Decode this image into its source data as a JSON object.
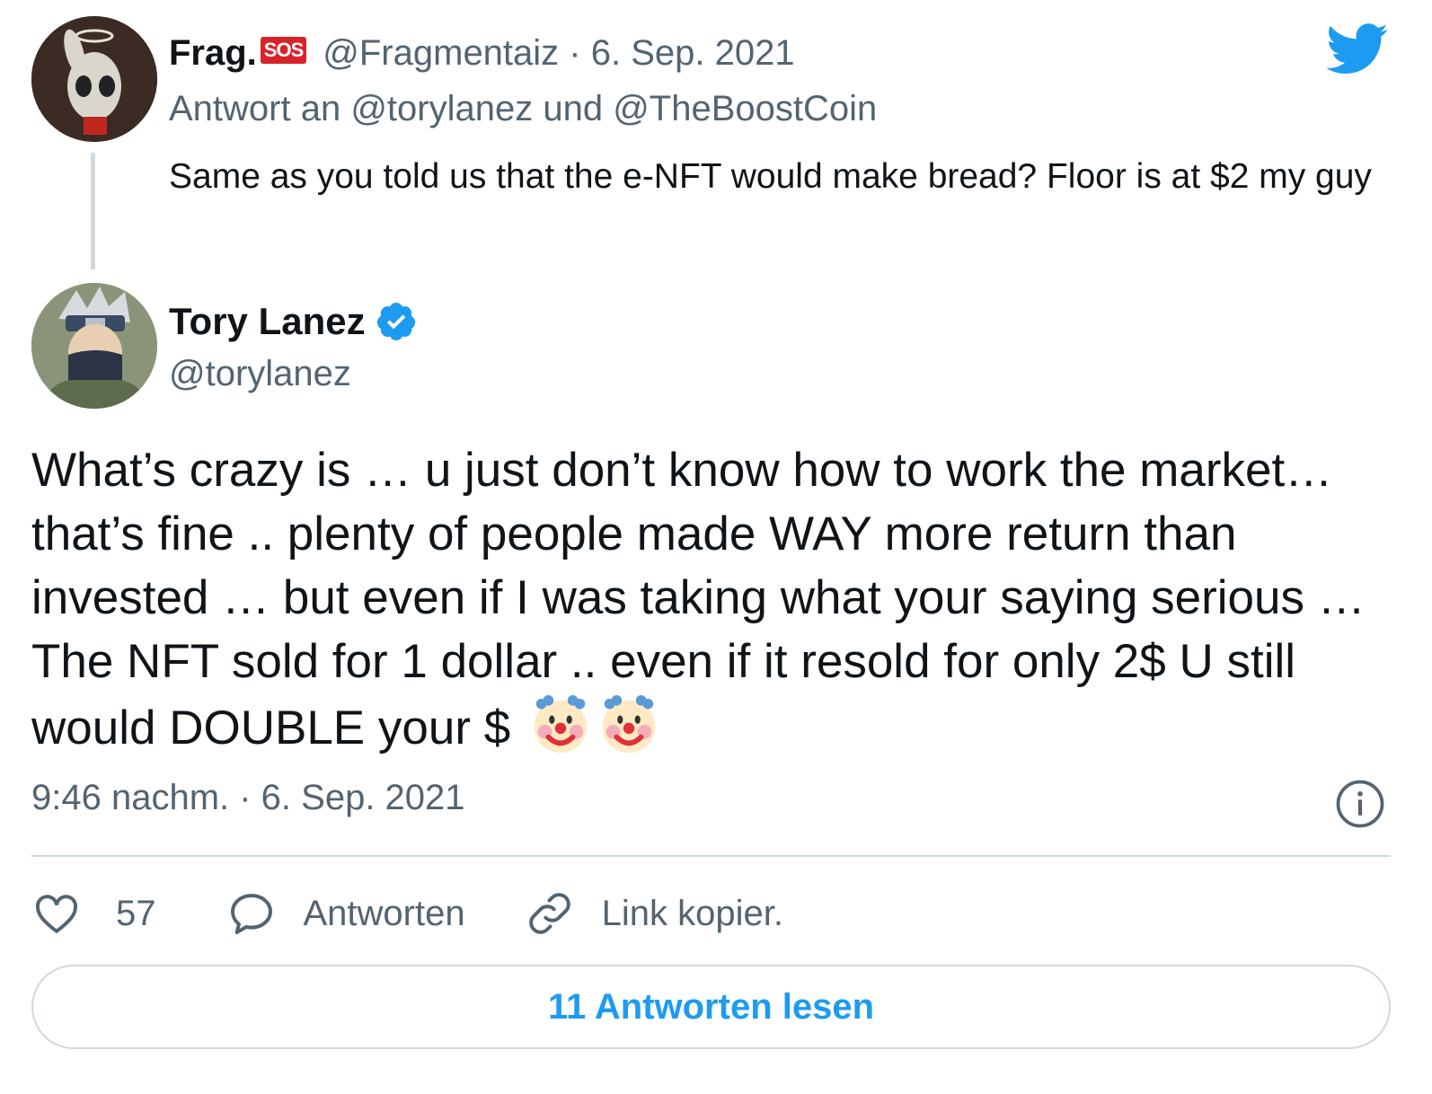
{
  "parent_tweet": {
    "display_name": "Frag.",
    "badge": "SOS",
    "handle_date": "@Fragmentaiz · 6. Sep. 2021",
    "reply_to": "Antwort an @torylanez und @TheBoostCoin",
    "text": "Same as you told us that the e-NFT would make bread? Floor is at $2 my guy"
  },
  "main_tweet": {
    "display_name": "Tory Lanez",
    "handle": "@torylanez",
    "verified": true,
    "text": "What’s crazy is … u just don’t know how to work the market… that’s fine .. plenty of people made WAY more return than invested … but even if I was taking what your saying serious … The NFT sold for 1 dollar .. even if it resold for only 2$ U still would DOUBLE your $",
    "emojis": [
      "clown-face",
      "clown-face"
    ],
    "timestamp": "9:46 nachm. · 6. Sep. 2021"
  },
  "actions": {
    "like_count": "57",
    "reply_label": "Antworten",
    "copy_link_label": "Link kopier."
  },
  "read_replies_label": "11 Antworten lesen",
  "colors": {
    "twitter_blue": "#1d9bf0",
    "muted_text": "#536471",
    "border": "#cfd9de",
    "badge_red": "#d8232a"
  }
}
